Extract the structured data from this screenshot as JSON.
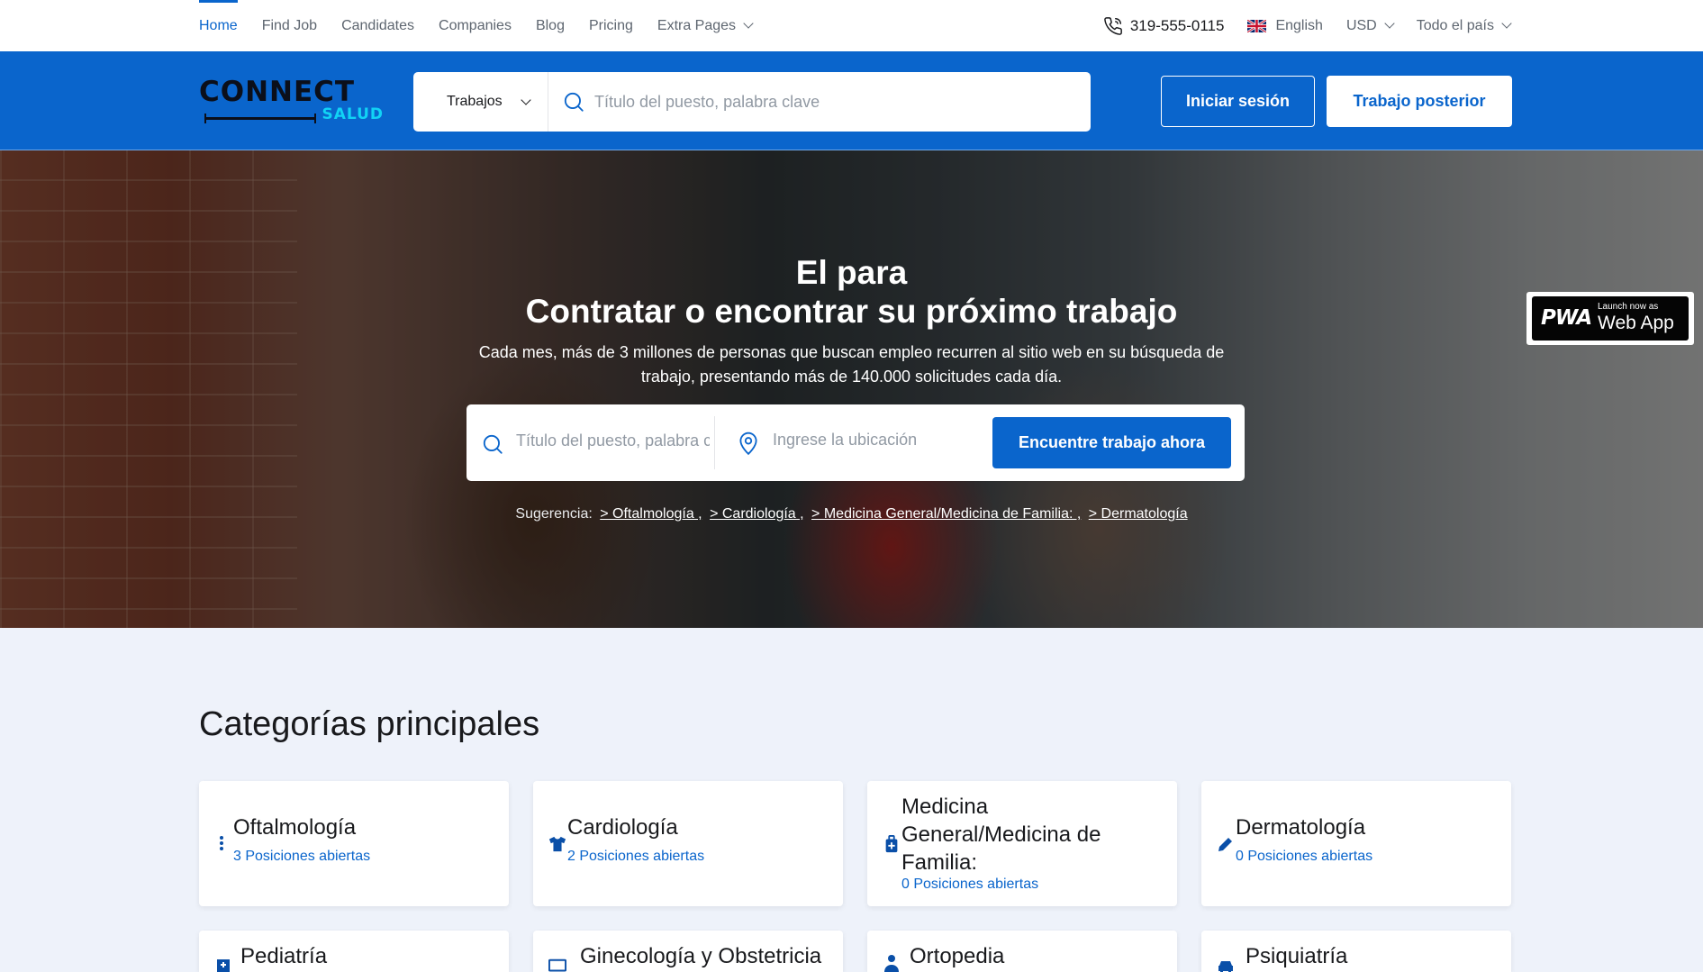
{
  "topnav": {
    "items": [
      {
        "label": "Home",
        "active": true
      },
      {
        "label": "Find Job"
      },
      {
        "label": "Candidates"
      },
      {
        "label": "Companies"
      },
      {
        "label": "Blog"
      },
      {
        "label": "Pricing"
      },
      {
        "label": "Extra Pages"
      }
    ]
  },
  "topright": {
    "phone": "319-555-0115",
    "language": "English",
    "currency": "USD",
    "country": "Todo el país"
  },
  "header": {
    "logo_top": "CONNECT",
    "logo_sub": "SALUD",
    "search_type": "Trabajos",
    "search_placeholder": "Título del puesto, palabra clave",
    "login_label": "Iniciar sesión",
    "post_job_label": "Trabajo posterior"
  },
  "hero": {
    "title_line1": "El para",
    "title_line2": "Contratar o encontrar su próximo trabajo",
    "description": "Cada mes, más de 3 millones de personas que buscan empleo recurren al sitio web en su búsqueda de trabajo, presentando más de 140.000 solicitudes cada día.",
    "search_placeholder": "Título del puesto, palabra clave",
    "location_placeholder": "Ingrese la ubicación",
    "search_button": "Encuentre trabajo ahora",
    "suggestion_label": "Sugerencia:",
    "suggestions": [
      "> Oftalmología ,",
      "> Cardiología ,",
      "> Medicina General/Medicina de Familia: ,",
      "> Dermatología"
    ]
  },
  "pwa": {
    "logo": "PWA",
    "small": "Launch now as",
    "big": "Web App"
  },
  "categories": {
    "title": "Categorías principales",
    "items": [
      {
        "name": "Oftalmología",
        "count": "3 Posiciones abiertas",
        "icon": "dots-vertical-icon"
      },
      {
        "name": "Cardiología",
        "count": "2 Posiciones abiertas",
        "icon": "shirt-icon"
      },
      {
        "name": "Medicina General/Medicina de Familia:",
        "count": "0 Posiciones abiertas",
        "icon": "medical-kit-icon"
      },
      {
        "name": "Dermatología",
        "count": "0 Posiciones abiertas",
        "icon": "pencil-icon"
      },
      {
        "name": "Pediatría",
        "icon": "hospital-icon"
      },
      {
        "name": "Ginecología y Obstetricia",
        "icon": "monitor-icon"
      },
      {
        "name": "Ortopedia",
        "icon": "user-doctor-icon"
      },
      {
        "name": "Psiquiatría",
        "icon": "car-icon"
      }
    ]
  },
  "colors": {
    "primary": "#0a65cc",
    "logo_accent": "#11d3f5",
    "page_bg": "#eef2fa"
  }
}
